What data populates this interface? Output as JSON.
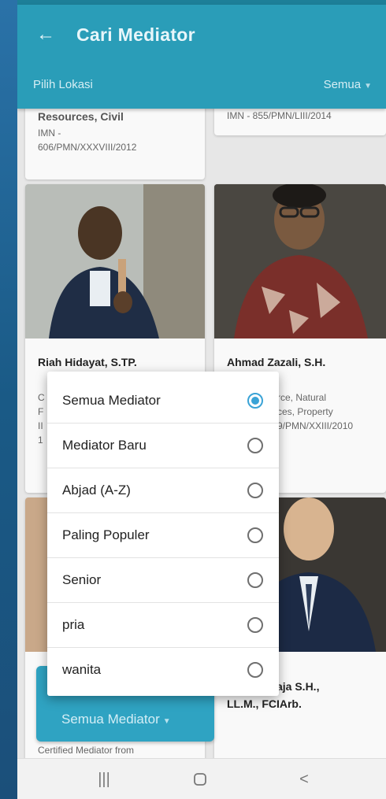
{
  "appbar": {
    "title": "Cari Mediator",
    "location_label": "Pilih Lokasi",
    "location_value": "Semua"
  },
  "cards": [
    {
      "name": "Resources, Civil",
      "lines": [
        "IMN -",
        "606/PMN/XXXVIII/2012"
      ]
    },
    {
      "name": "",
      "lines": [
        "IMN - 855/PMN/LIII/2014"
      ]
    },
    {
      "name": "Riah Hidayat, S.TP.",
      "lines": [
        "C",
        "F",
        "II",
        "1"
      ]
    },
    {
      "name": "Ahmad Zazali, S.H.",
      "lines": [
        "rce, Natural",
        "ces, Property",
        "9/PMN/XXIII/2010"
      ]
    },
    {
      "name": "",
      "lines": [
        "Certified Mediator from"
      ]
    },
    {
      "name": "..., Budidjaja S.H.,",
      "lines": [
        "LL.M., FCIArb."
      ]
    }
  ],
  "filter_button": {
    "label": "Semua Mediator"
  },
  "sort_dialog": {
    "options": [
      {
        "label": "Semua Mediator",
        "selected": true
      },
      {
        "label": "Mediator Baru",
        "selected": false
      },
      {
        "label": "Abjad (A-Z)",
        "selected": false
      },
      {
        "label": "Paling Populer",
        "selected": false
      },
      {
        "label": "Senior",
        "selected": false
      },
      {
        "label": "pria",
        "selected": false
      },
      {
        "label": "wanita",
        "selected": false
      }
    ]
  },
  "colors": {
    "appbar": "#2a9db8",
    "accent": "#3aa3d6",
    "chip": "#2fa3c2"
  },
  "icons": {
    "back": "arrow-left-icon",
    "recents": "recents-icon",
    "home": "home-icon",
    "back_nav": "back-nav-icon"
  }
}
